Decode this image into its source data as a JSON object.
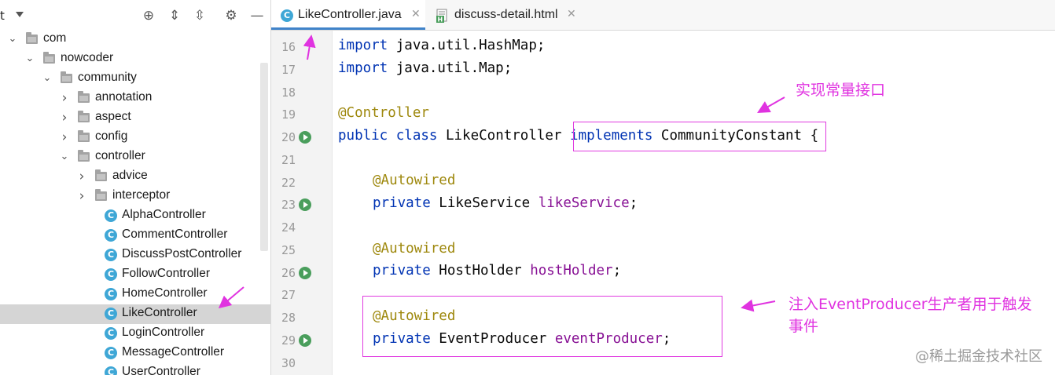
{
  "project_panel": {
    "title_fragment": "t",
    "tree": [
      {
        "label": "com",
        "kind": "folder",
        "expanded": true
      },
      {
        "label": "nowcoder",
        "kind": "folder",
        "expanded": true
      },
      {
        "label": "community",
        "kind": "folder",
        "expanded": true
      },
      {
        "label": "annotation",
        "kind": "folder",
        "expanded": false
      },
      {
        "label": "aspect",
        "kind": "folder",
        "expanded": false
      },
      {
        "label": "config",
        "kind": "folder",
        "expanded": false
      },
      {
        "label": "controller",
        "kind": "folder",
        "expanded": true
      },
      {
        "label": "advice",
        "kind": "folder",
        "expanded": false
      },
      {
        "label": "interceptor",
        "kind": "folder",
        "expanded": false
      },
      {
        "label": "AlphaController",
        "kind": "class"
      },
      {
        "label": "CommentController",
        "kind": "class"
      },
      {
        "label": "DiscussPostController",
        "kind": "class"
      },
      {
        "label": "FollowController",
        "kind": "class"
      },
      {
        "label": "HomeController",
        "kind": "class"
      },
      {
        "label": "LikeController",
        "kind": "class",
        "selected": true
      },
      {
        "label": "LoginController",
        "kind": "class"
      },
      {
        "label": "MessageController",
        "kind": "class"
      },
      {
        "label": "UserController",
        "kind": "class"
      }
    ]
  },
  "tabs": [
    {
      "label": "LikeController.java",
      "active": true,
      "icon": "java-class-icon"
    },
    {
      "label": "discuss-detail.html",
      "active": false,
      "icon": "html-file-icon"
    }
  ],
  "editor": {
    "line_numbers": [
      "16",
      "17",
      "18",
      "19",
      "20",
      "21",
      "22",
      "23",
      "24",
      "25",
      "26",
      "27",
      "28",
      "29",
      "30"
    ],
    "lines": {
      "l16_kw": "import",
      "l16_rest": " java.util.HashMap;",
      "l17_kw": "import",
      "l17_rest": " java.util.Map;",
      "l19_ann": "@Controller",
      "l20_kw1": "public",
      "l20_kw2": "class",
      "l20_name": " LikeController ",
      "l20_impl": "implements",
      "l20_iface": " CommunityConstant",
      "l20_brace": " {",
      "l22_ann": "@Autowired",
      "l23_kw": "private",
      "l23_type": " LikeService ",
      "l23_field": "likeService",
      "l23_end": ";",
      "l25_ann": "@Autowired",
      "l26_kw": "private",
      "l26_type": " HostHolder ",
      "l26_field": "hostHolder",
      "l26_end": ";",
      "l28_ann": "@Autowired",
      "l29_kw": "private",
      "l29_type": " EventProducer ",
      "l29_field": "eventProducer",
      "l29_end": ";"
    }
  },
  "annotations": {
    "note1": "实现常量接口",
    "note2_line1": "注入EventProducer生产者用于触发",
    "note2_line2": "事件",
    "color": "#e033e0"
  },
  "watermark": "@稀土掘金技术社区"
}
